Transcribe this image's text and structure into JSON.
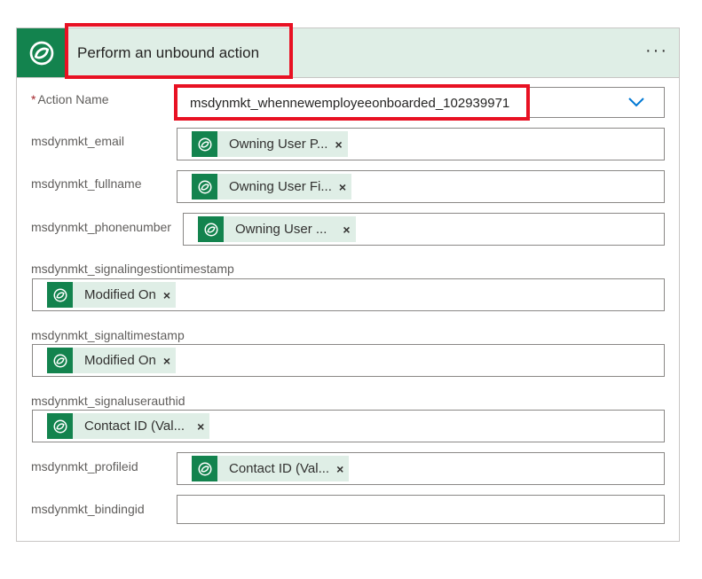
{
  "header": {
    "title": "Perform an unbound action",
    "more_label": "···",
    "icon": "dataverse-icon",
    "accent": "#13834e",
    "tint": "#dfeee6"
  },
  "fields": {
    "action_name": {
      "required_mark": "*",
      "label": "Action Name",
      "value": "msdynmkt_whennewemployeeonboarded_102939971"
    },
    "email": {
      "label": "msdynmkt_email",
      "token": "Owning User P..."
    },
    "fullname": {
      "label": "msdynmkt_fullname",
      "token": "Owning User Fi..."
    },
    "phonenumber": {
      "label": "msdynmkt_phonenumber",
      "token": "Owning User ..."
    },
    "signalingestiontimestamp": {
      "label": "msdynmkt_signalingestiontimestamp",
      "token": "Modified On"
    },
    "signaltimestamp": {
      "label": "msdynmkt_signaltimestamp",
      "token": "Modified On"
    },
    "signaluserauthid": {
      "label": "msdynmkt_signaluserauthid",
      "token": "Contact ID (Val..."
    },
    "profileid": {
      "label": "msdynmkt_profileid",
      "token": "Contact ID (Val..."
    },
    "bindingid": {
      "label": "msdynmkt_bindingid",
      "value": ""
    }
  },
  "token_remove": "×",
  "highlight_color": "#e81123"
}
